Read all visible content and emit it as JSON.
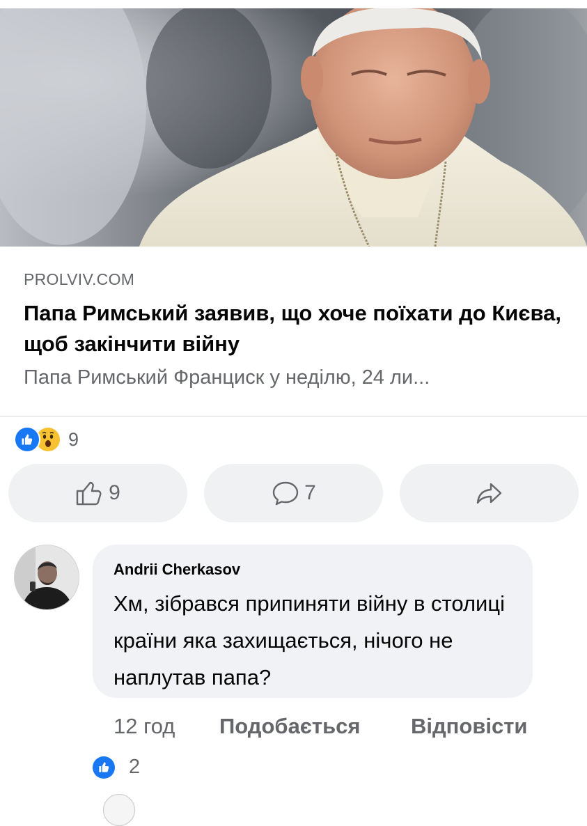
{
  "post": {
    "image": {
      "alt": "pope-portrait-photo"
    },
    "link_preview": {
      "source": "PROLVIV.COM",
      "headline": "Папа Римський заявив, що хоче поїхати до Києва, щоб закінчити війну",
      "description": "Папа Римський Франциск у неділю, 24 ли..."
    },
    "reactions": {
      "icons": [
        "like-icon",
        "wow-icon"
      ],
      "count": "9"
    },
    "actions": [
      {
        "icon": "thumb-up-outline-icon",
        "count": "9"
      },
      {
        "icon": "comment-bubble-icon",
        "count": "7"
      },
      {
        "icon": "share-arrow-icon",
        "count": ""
      }
    ]
  },
  "comment": {
    "author": "Andrii Cherkasov",
    "text": "Хм, зібрався припиняти війну в столиці країни яка захищається, нічого не наплутав папа?",
    "time": "12 год",
    "like_label": "Подобається",
    "reply_label": "Відповісти",
    "reaction_count": "2"
  },
  "colors": {
    "accent": "#1877f2",
    "secondary_text": "#65676b",
    "bubble_bg": "#f0f2f5",
    "button_bg": "#eff1f3"
  }
}
